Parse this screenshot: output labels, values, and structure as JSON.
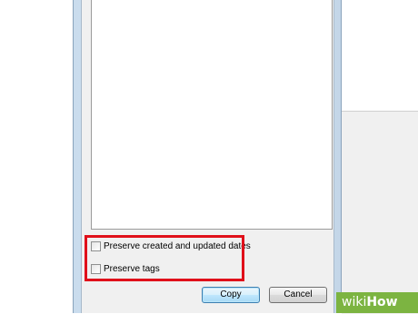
{
  "dialog": {
    "options": [
      {
        "label": "Preserve created and updated dates",
        "checked": false
      },
      {
        "label": "Preserve tags",
        "checked": false
      }
    ],
    "buttons": {
      "copy_label": "Copy",
      "cancel_label": "Cancel"
    }
  },
  "watermark": {
    "prefix": "wiki",
    "suffix": "How"
  },
  "colors": {
    "highlight": "#e0101a",
    "watermark_bg": "#7cb441"
  }
}
